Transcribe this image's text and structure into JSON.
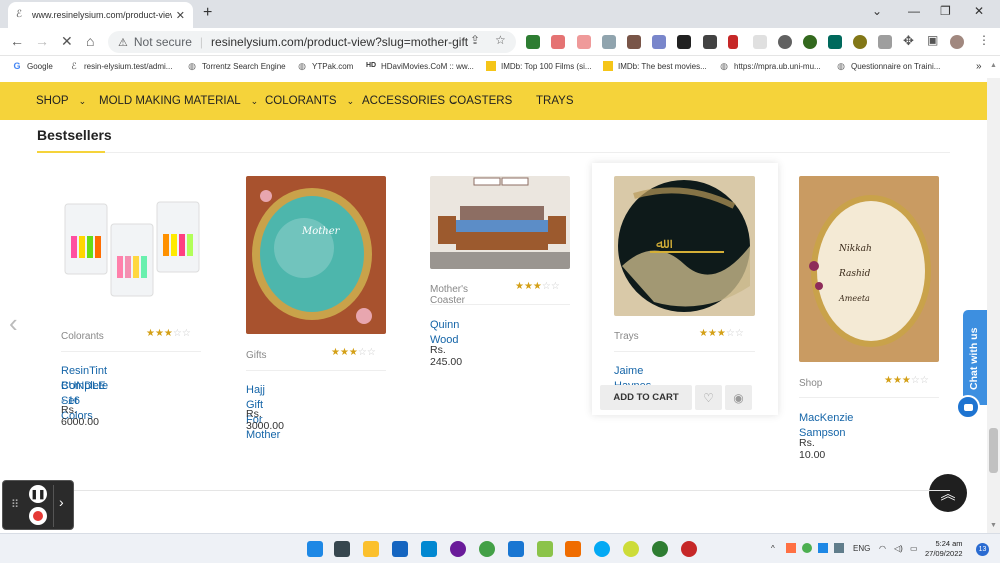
{
  "browser": {
    "tab_title": "www.resinelysium.com/product-view?sl",
    "new_tab": "+",
    "nav_back": "←",
    "nav_forward": "→",
    "nav_reload": "✕",
    "nav_home": "⌂",
    "security_label": "Not secure",
    "url": "resinelysium.com/product-view?slug=mother-gift",
    "bookmarks": [
      {
        "label": "Google"
      },
      {
        "label": "resin-elysium.test/admi..."
      },
      {
        "label": "Torrentz Search Engine"
      },
      {
        "label": "YTPak.com"
      },
      {
        "label": "HDaviMovies.CoM :: ww..."
      },
      {
        "label": "IMDb: Top 100 Films (si..."
      },
      {
        "label": "IMDb: The best movies..."
      },
      {
        "label": "https://mpra.ub.uni-mu..."
      },
      {
        "label": "Questionnaire on Traini..."
      }
    ]
  },
  "site_nav": [
    {
      "label": "SHOP",
      "dropdown": true
    },
    {
      "label": "MOLD MAKING MATERIAL",
      "dropdown": true
    },
    {
      "label": "COLORANTS",
      "dropdown": true
    },
    {
      "label": "ACCESSORIES",
      "dropdown": true
    },
    {
      "label": "COASTERS",
      "dropdown": false
    },
    {
      "label": "TRAYS",
      "dropdown": false
    }
  ],
  "section": {
    "title": "Bestsellers"
  },
  "products": [
    {
      "category": "Colorants",
      "name_line1": "ResinTint Complete Set",
      "name_line2": "BUNDLE - 16 Colors",
      "price": "Rs. 6000.00",
      "rating": 3
    },
    {
      "category": "Gifts",
      "name_line1": "Hajj Gift For Mother",
      "name_line2": "",
      "price": "Rs. 3000.00",
      "rating": 3
    },
    {
      "category": "Mother's Coaster",
      "name_line1": "Quinn Wood",
      "name_line2": "",
      "price": "Rs. 245.00",
      "rating": 3
    },
    {
      "category": "Trays",
      "name_line1": "Jaime Haynes",
      "name_line2": "",
      "price": "",
      "rating": 3
    },
    {
      "category": "Shop",
      "name_line1": "MacKenzie Sampson",
      "name_line2": "",
      "price": "Rs. 10.00",
      "rating": 3
    }
  ],
  "add_to_cart": "ADD TO CART",
  "chat": {
    "label": "Chat with us"
  },
  "taskbar": {
    "lang": "ENG",
    "time": "5:24 am",
    "date": "27/09/2022",
    "notifications": "13"
  }
}
